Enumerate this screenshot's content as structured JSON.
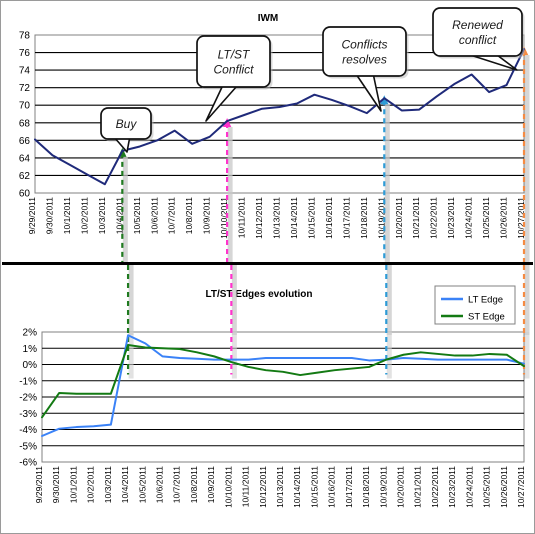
{
  "figure": {
    "background_color": "#ffffff",
    "border_color": "#9a9a9a",
    "divider_color": "#000000"
  },
  "colors": {
    "price_line": "#1f2a7a",
    "lt_edge": "#3a82f7",
    "st_edge": "#137a13",
    "buy_marker": "#1f7a1f",
    "conflict_marker": "#ff33cc",
    "resolve_marker": "#2e9bd6",
    "renewed_marker": "#f58b43",
    "gridline": "#000000",
    "axis": "#808080"
  },
  "top_chart": {
    "title": "IWM",
    "callouts": [
      {
        "id": "buy",
        "lines": [
          "Buy"
        ],
        "marker_color": "#1f7a1f",
        "anchor_date": "10/4/2011"
      },
      {
        "id": "lt-st-conflict",
        "lines": [
          "LT/ST",
          "Conflict"
        ],
        "marker_color": "#ff33cc",
        "anchor_date": "10/10/2011"
      },
      {
        "id": "conflicts-resolves",
        "lines": [
          "Conflicts",
          "resolves"
        ],
        "marker_color": "#2e9bd6",
        "anchor_date": "10/19/2011"
      },
      {
        "id": "renewed-conflict",
        "lines": [
          "Renewed",
          "conflict"
        ],
        "marker_color": "#f58b43",
        "anchor_date": "10/27/2011"
      }
    ]
  },
  "bottom_chart": {
    "title": "LT/ST Edges evolution",
    "legend": [
      {
        "label": "LT Edge",
        "color": "#3a82f7"
      },
      {
        "label": "ST Edge",
        "color": "#137a13"
      }
    ]
  },
  "chart_data": [
    {
      "type": "line",
      "id": "iwm-price",
      "title": "IWM",
      "xlabel": "",
      "ylabel": "",
      "ylim": [
        60,
        78
      ],
      "ytick_step": 2,
      "yticks": [
        60,
        62,
        64,
        66,
        68,
        70,
        72,
        74,
        76,
        78
      ],
      "grid": true,
      "legend": false,
      "categories": [
        "9/29/2011",
        "9/30/2011",
        "10/1/2011",
        "10/2/2011",
        "10/3/2011",
        "10/4/2011",
        "10/5/2011",
        "10/6/2011",
        "10/7/2011",
        "10/8/2011",
        "10/9/2011",
        "10/10/2011",
        "10/11/2011",
        "10/12/2011",
        "10/13/2011",
        "10/14/2011",
        "10/15/2011",
        "10/16/2011",
        "10/17/2011",
        "10/18/2011",
        "10/19/2011",
        "10/20/2011",
        "10/21/2011",
        "10/22/2011",
        "10/23/2011",
        "10/24/2011",
        "10/25/2011",
        "10/26/2011",
        "10/27/2011"
      ],
      "series": [
        {
          "name": "IWM",
          "color": "#1f2a7a",
          "values": [
            66.1,
            64.3,
            63.2,
            62.1,
            61.0,
            64.8,
            65.3,
            66.0,
            67.1,
            65.6,
            66.4,
            68.2,
            68.9,
            69.6,
            69.8,
            70.2,
            71.2,
            70.6,
            69.9,
            69.1,
            70.8,
            69.4,
            69.5,
            71.0,
            72.4,
            73.5,
            71.5,
            72.3,
            76.4
          ]
        }
      ],
      "annotations": [
        {
          "text": "Buy",
          "x": "10/4/2011",
          "y": 64.8,
          "marker": "up-arrow",
          "color": "#1f7a1f"
        },
        {
          "text": "LT/ST Conflict",
          "x": "10/10/2011",
          "y": 68.2,
          "marker": "up-arrow",
          "color": "#ff33cc"
        },
        {
          "text": "Conflicts resolves",
          "x": "10/19/2011",
          "y": 69.4,
          "marker": "up-arrow",
          "color": "#2e9bd6"
        },
        {
          "text": "Renewed conflict",
          "x": "10/27/2011",
          "y": 76.4,
          "marker": "up-arrow",
          "color": "#f58b43"
        }
      ]
    },
    {
      "type": "line",
      "id": "lt-st-edges",
      "title": "LT/ST Edges evolution",
      "xlabel": "",
      "ylabel": "",
      "ylim": [
        -6,
        2
      ],
      "ytick_step": 1,
      "yticks": [
        2,
        1,
        0,
        -1,
        -2,
        -3,
        -4,
        -5,
        -6
      ],
      "ytick_labels": [
        "2%",
        "1%",
        "0%",
        "-1%",
        "-2%",
        "-3%",
        "-4%",
        "-5%",
        "-6%"
      ],
      "grid": true,
      "legend": true,
      "legend_position": "top-right",
      "categories": [
        "9/29/2011",
        "9/30/2011",
        "10/1/2011",
        "10/2/2011",
        "10/3/2011",
        "10/4/2011",
        "10/5/2011",
        "10/6/2011",
        "10/7/2011",
        "10/8/2011",
        "10/9/2011",
        "10/10/2011",
        "10/11/2011",
        "10/12/2011",
        "10/13/2011",
        "10/14/2011",
        "10/15/2011",
        "10/16/2011",
        "10/17/2011",
        "10/18/2011",
        "10/19/2011",
        "10/20/2011",
        "10/21/2011",
        "10/22/2011",
        "10/23/2011",
        "10/24/2011",
        "10/25/2011",
        "10/26/2011",
        "10/27/2011"
      ],
      "series": [
        {
          "name": "LT Edge",
          "color": "#3a82f7",
          "values": [
            -4.4,
            -3.95,
            -3.85,
            -3.8,
            -3.7,
            1.8,
            1.3,
            0.5,
            0.4,
            0.35,
            0.3,
            0.3,
            0.3,
            0.4,
            0.4,
            0.4,
            0.4,
            0.4,
            0.4,
            0.25,
            0.3,
            0.4,
            0.35,
            0.3,
            0.3,
            0.3,
            0.3,
            0.3,
            0.05
          ]
        },
        {
          "name": "ST Edge",
          "color": "#137a13",
          "values": [
            -3.25,
            -1.75,
            -1.8,
            -1.8,
            -1.8,
            1.2,
            1.05,
            1.0,
            0.95,
            0.75,
            0.5,
            0.15,
            -0.15,
            -0.35,
            -0.45,
            -0.65,
            -0.5,
            -0.35,
            -0.25,
            -0.15,
            0.3,
            0.6,
            0.75,
            0.65,
            0.55,
            0.55,
            0.65,
            0.6,
            -0.1
          ]
        }
      ],
      "annotations": [
        {
          "x": "10/4/2011",
          "marker": "vline",
          "color": "#1f7a1f"
        },
        {
          "x": "10/10/2011",
          "marker": "vline",
          "color": "#ff33cc"
        },
        {
          "x": "10/19/2011",
          "marker": "vline",
          "color": "#2e9bd6"
        },
        {
          "x": "10/27/2011",
          "marker": "vline",
          "color": "#f58b43"
        }
      ]
    }
  ]
}
